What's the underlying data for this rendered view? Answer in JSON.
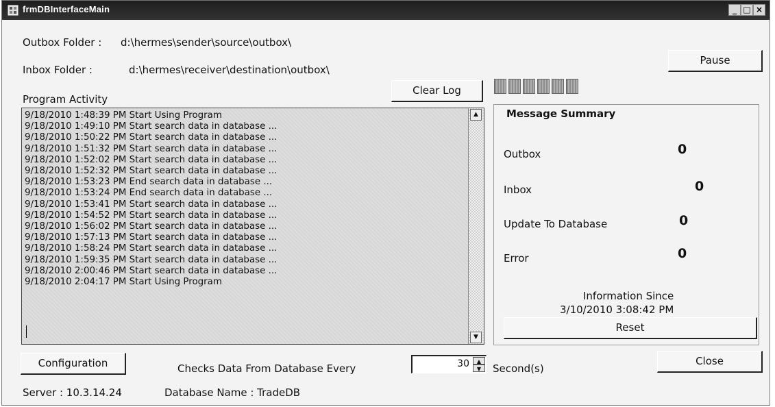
{
  "window": {
    "title": "frmDBInterfaceMain",
    "min_label": "_",
    "max_label": "□",
    "close_label": "×"
  },
  "folders": {
    "outbox_label": "Outbox Folder :",
    "outbox_path": "d:\\hermes\\sender\\source\\outbox\\",
    "inbox_label": "Inbox Folder :",
    "inbox_path": "d:\\hermes\\receiver\\destination\\outbox\\"
  },
  "buttons": {
    "pause": "Pause",
    "clear_log": "Clear Log",
    "reset": "Reset",
    "configuration": "Configuration",
    "close": "Close"
  },
  "activity": {
    "label": "Program Activity",
    "lines": [
      "9/18/2010 1:48:39 PM Start Using Program",
      "9/18/2010 1:49:10 PM Start search data in database ...",
      "9/18/2010 1:50:22 PM Start search data in database ...",
      "9/18/2010 1:51:32 PM Start search data in database ...",
      "9/18/2010 1:52:02 PM Start search data in database ...",
      "9/18/2010 1:52:32 PM Start search data in database ...",
      "9/18/2010 1:53:23 PM End search data in database ...",
      "9/18/2010 1:53:24 PM End search data in database ...",
      "9/18/2010 1:53:41 PM Start search data in database ...",
      "9/18/2010 1:54:52 PM Start search data in database ...",
      "9/18/2010 1:56:02 PM Start search data in database ...",
      "9/18/2010 1:57:13 PM Start search data in database ...",
      "9/18/2010 1:58:24 PM Start search data in database ...",
      "9/18/2010 1:59:35 PM Start search data in database ...",
      "9/18/2010 2:00:46 PM Start search data in database ...",
      "9/18/2010 2:04:17 PM Start Using Program"
    ]
  },
  "summary": {
    "title": "Message Summary",
    "outbox_label": "Outbox",
    "outbox_count": "0",
    "inbox_label": "Inbox",
    "inbox_count": "0",
    "update_label": "Update To Database",
    "update_count": "0",
    "error_label": "Error",
    "error_count": "0",
    "since_label": "Information Since",
    "since_value": "3/10/2010 3:08:42 PM"
  },
  "progress": {
    "blocks_filled": 6
  },
  "schedule": {
    "label": "Checks Data From Database Every",
    "value": "30",
    "unit": "Second(s)"
  },
  "footer": {
    "server": "Server : 10.3.14.24",
    "database": "Database Name : TradeDB"
  }
}
